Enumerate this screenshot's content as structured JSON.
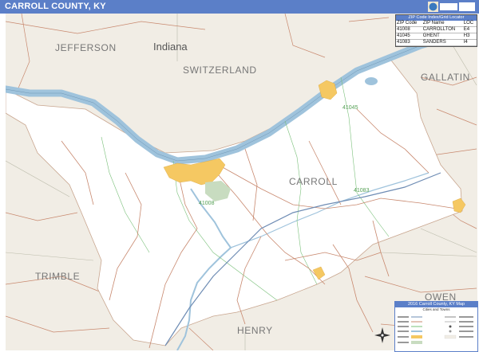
{
  "title": "CARROLL COUNTY, KY",
  "labels": {
    "indiana": "Indiana",
    "jefferson": "JEFFERSON",
    "switzerland": "SWITZERLAND",
    "gallatin": "GALLATIN",
    "trimble": "TRIMBLE",
    "owen": "OWEN",
    "henry": "HENRY",
    "carroll": "CARROLL"
  },
  "zips_on_map": [
    "41045",
    "41083",
    "41008"
  ],
  "zip_table": {
    "header": "ZIP Code Index/Grid Locator",
    "columns": [
      "ZIP Code",
      "ZIP Name",
      "LOC"
    ],
    "rows": [
      [
        "41008",
        "CARROLLTON",
        "E4"
      ],
      [
        "41045",
        "GHENT",
        "H3"
      ],
      [
        "41083",
        "SANDERS",
        "I4"
      ]
    ]
  },
  "legend": {
    "header": "2016 Carroll County, KY Map",
    "subheader": "Cities and Towns"
  },
  "colors": {
    "title_bar": "#5b7fc8",
    "river": "#9fc3dc",
    "county_fill": "#ffffff",
    "outside_fill": "#f1ede5",
    "city_fill": "#f5c862",
    "zip_text": "#55a055"
  }
}
